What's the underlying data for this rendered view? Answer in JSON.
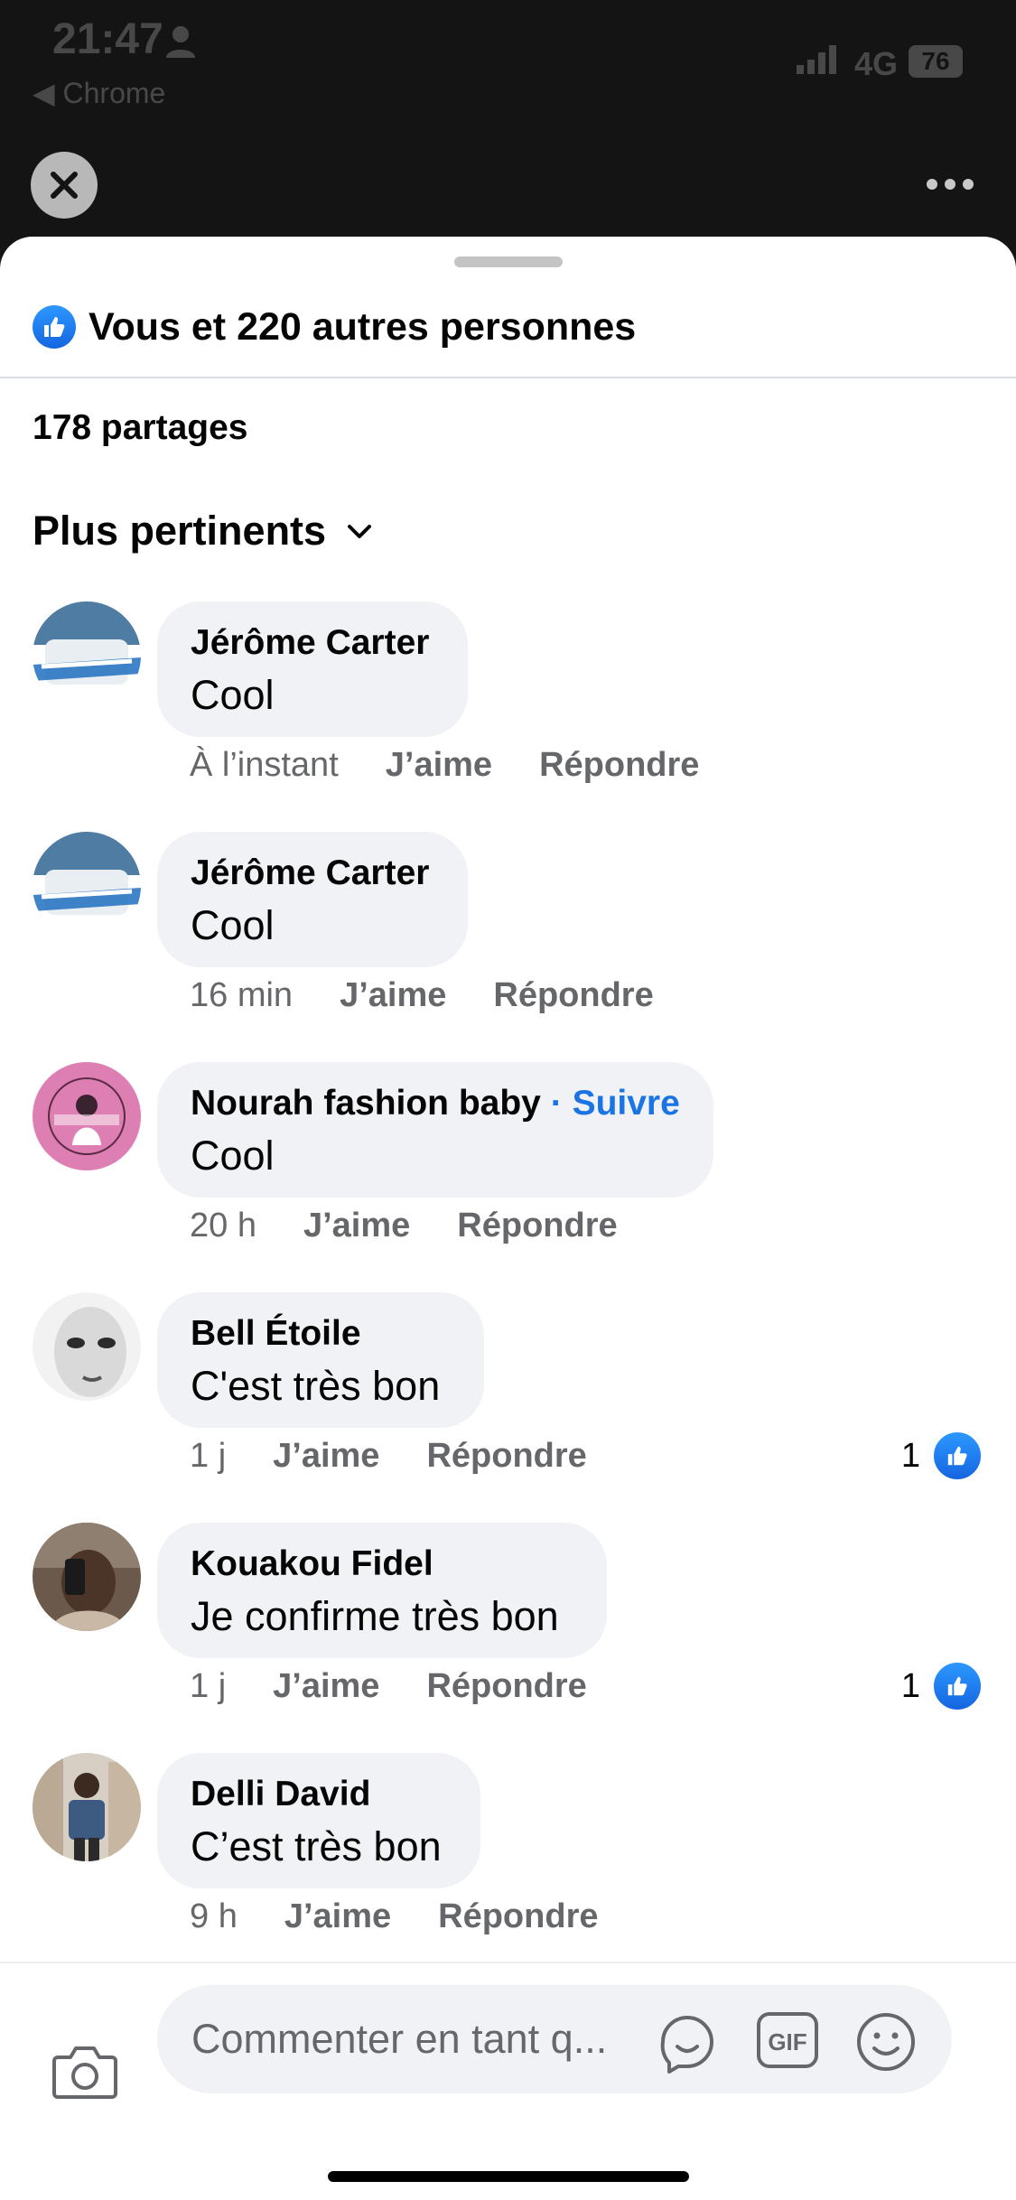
{
  "status_bar": {
    "time": "21:47",
    "back_label": "◀ Chrome",
    "network": "4G",
    "battery": "76"
  },
  "header": {
    "reactions_text": "Vous et 220 autres personnes",
    "shares": "178 partages",
    "sort_label": "Plus pertinents"
  },
  "comments": [
    {
      "author": "Jérôme Carter",
      "text": "Cool",
      "time": "À l’instant",
      "like": "J’aime",
      "reply": "Répondre",
      "reactions": "",
      "follow": ""
    },
    {
      "author": "Jérôme Carter",
      "text": "Cool",
      "time": "16 min",
      "like": "J’aime",
      "reply": "Répondre",
      "reactions": "",
      "follow": ""
    },
    {
      "author": "Nourah fashion baby",
      "text": "Cool",
      "time": "20 h",
      "like": "J’aime",
      "reply": "Répondre",
      "reactions": "",
      "follow": "Suivre",
      "follow_separator": "·"
    },
    {
      "author": "Bell Étoile",
      "text": "C'est très bon",
      "time": "1 j",
      "like": "J’aime",
      "reply": "Répondre",
      "reactions": "1",
      "follow": ""
    },
    {
      "author": "Kouakou Fidel",
      "text": "Je confirme très bon",
      "time": "1 j",
      "like": "J’aime",
      "reply": "Répondre",
      "reactions": "1",
      "follow": ""
    },
    {
      "author": "Delli David",
      "text": "C’est très bon",
      "time": "9 h",
      "like": "J’aime",
      "reply": "Répondre",
      "reactions": "",
      "follow": ""
    }
  ],
  "composer": {
    "placeholder": "Commenter en tant q...",
    "gif_label": "GIF"
  },
  "colors": {
    "accent": "#1b74e4",
    "bubble": "#f0f2f5",
    "secondary_text": "#65676b"
  }
}
